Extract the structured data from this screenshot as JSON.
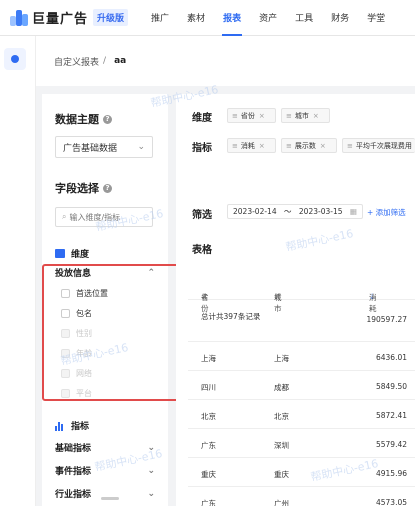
{
  "app": {
    "brand": "巨量广告",
    "edition": "升级版",
    "nav": [
      "推广",
      "素材",
      "报表",
      "资产",
      "工具",
      "财务",
      "学堂"
    ],
    "active_nav": "报表",
    "brand_color": "#2e6bf2"
  },
  "breadcrumb": {
    "parent": "自定义报表",
    "separator": "/",
    "current": "aa"
  },
  "left": {
    "data_subject_title": "数据主题",
    "data_subject_value": "广告基础数据",
    "field_select_title": "字段选择",
    "search_placeholder": "输入维度/指标",
    "dimension_label": "维度",
    "group_label": "投放信息",
    "group_items": [
      {
        "label": "首选位置",
        "disabled": false
      },
      {
        "label": "包名",
        "disabled": false
      },
      {
        "label": "性别",
        "disabled": true
      },
      {
        "label": "年龄",
        "disabled": true
      },
      {
        "label": "网络",
        "disabled": true
      },
      {
        "label": "平台",
        "disabled": true
      }
    ],
    "metric_label": "指标",
    "metric_groups": [
      "基础指标",
      "事件指标",
      "行业指标"
    ]
  },
  "right": {
    "dimension_label": "维度",
    "dimension_tags": [
      "省份",
      "城市"
    ],
    "metric_label": "指标",
    "metric_tags": [
      "消耗",
      "展示数",
      "平均千次展现费用"
    ],
    "filter_label": "筛选",
    "date_start": "2023-02-14",
    "date_sep": "～",
    "date_end": "2023-03-15",
    "add_filter": "+ 添加筛选",
    "table_title": "表格",
    "columns": [
      "省份",
      "城市",
      "消耗"
    ],
    "total_label": "总计共397条记录",
    "total_value": "190597.27",
    "rows": [
      {
        "province": "上海",
        "city": "上海",
        "cost": "6436.01"
      },
      {
        "province": "四川",
        "city": "成都",
        "cost": "5849.50"
      },
      {
        "province": "北京",
        "city": "北京",
        "cost": "5872.41"
      },
      {
        "province": "广东",
        "city": "深圳",
        "cost": "5579.42"
      },
      {
        "province": "重庆",
        "city": "重庆",
        "cost": "4915.96"
      },
      {
        "province": "广东",
        "city": "广州",
        "cost": "4573.05"
      }
    ]
  },
  "watermark": "帮助中心-e16"
}
